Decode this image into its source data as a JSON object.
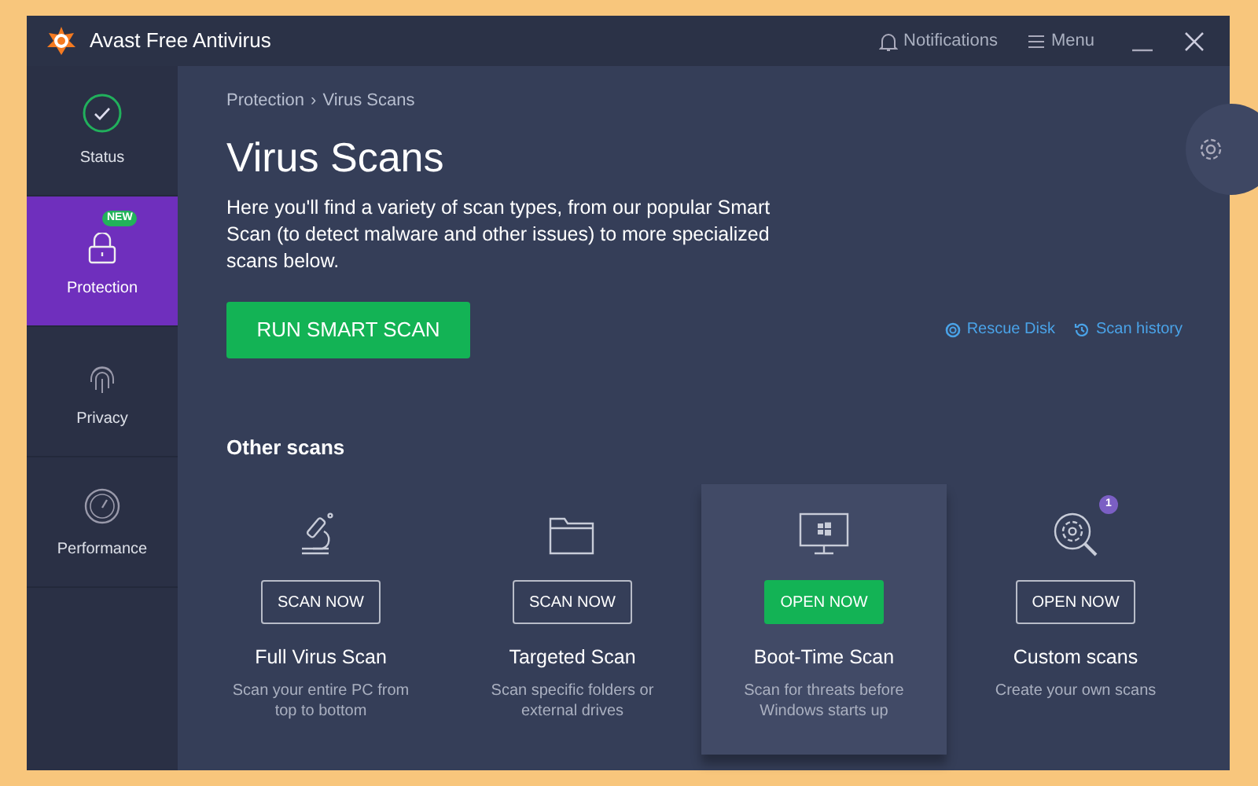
{
  "window": {
    "title": "Avast Free Antivirus",
    "actions": [
      {
        "kind": "notifications",
        "label": "Notifications"
      },
      {
        "kind": "menu",
        "label": "Menu"
      }
    ]
  },
  "sidebar": {
    "items": [
      {
        "kind": "status",
        "label": "Status",
        "selected": false
      },
      {
        "kind": "protection",
        "label": "Protection",
        "selected": true,
        "badge": "NEW"
      },
      {
        "kind": "privacy",
        "label": "Privacy",
        "selected": false
      },
      {
        "kind": "performance",
        "label": "Performance",
        "selected": false
      }
    ]
  },
  "breadcrumb": [
    "Protection",
    "›",
    "Virus Scans"
  ],
  "heading": "Virus Scans",
  "intro": "Here you'll find a variety of scan types, from our popular Smart Scan (to detect malware and other issues) to more specialized scans below.",
  "primary_button": "RUN SMART SCAN",
  "links": [
    {
      "kind": "rescue",
      "label": "Rescue Disk"
    },
    {
      "kind": "history",
      "label": "Scan history"
    }
  ],
  "section_title": "Other scans",
  "scans": [
    {
      "kind": "microscope",
      "button": "SCAN NOW",
      "title": "Full Virus Scan",
      "description": "Scan your entire PC from top to bottom",
      "highlighted": false
    },
    {
      "kind": "folder",
      "button": "SCAN NOW",
      "title": "Targeted Scan",
      "description": "Scan specific folders or external drives",
      "highlighted": false
    },
    {
      "kind": "monitor",
      "button": "OPEN NOW",
      "title": "Boot-Time Scan",
      "description": "Scan for threats before Windows starts up",
      "highlighted": true
    },
    {
      "kind": "gear-search",
      "button": "OPEN NOW",
      "title": "Custom scans",
      "description": "Create your own scans",
      "highlighted": false,
      "badge": "1"
    }
  ]
}
